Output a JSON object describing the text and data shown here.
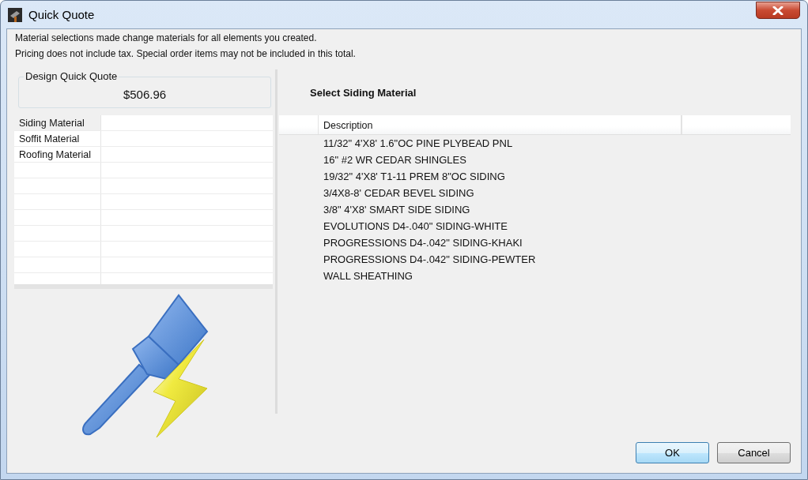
{
  "window": {
    "title": "Quick Quote"
  },
  "notes": [
    "Material selections made change materials for all elements you created.",
    "Pricing does not include tax. Special order items may not be included in this total."
  ],
  "quote": {
    "legend": "Design Quick Quote",
    "total": "$506.96"
  },
  "materials": [
    {
      "name": "Siding Material",
      "selected": true
    },
    {
      "name": "Soffit Material",
      "selected": false
    },
    {
      "name": "Roofing Material",
      "selected": false
    }
  ],
  "picker": {
    "title": "Select Siding Material",
    "columns": [
      "Description"
    ],
    "rows": [
      {
        "description": "11/32\" 4'X8' 1.6\"OC PINE PLYBEAD PNL"
      },
      {
        "description": "16\" #2 WR CEDAR SHINGLES"
      },
      {
        "description": "19/32\" 4'X8' T1-11 PREM 8\"OC SIDING"
      },
      {
        "description": "3/4X8-8' CEDAR BEVEL SIDING"
      },
      {
        "description": "3/8\" 4'X8' SMART SIDE SIDING"
      },
      {
        "description": "EVOLUTIONS D4-.040\" SIDING-WHITE"
      },
      {
        "description": "PROGRESSIONS D4-.042\" SIDING-KHAKI"
      },
      {
        "description": "PROGRESSIONS D4-.042\" SIDING-PEWTER"
      },
      {
        "description": "WALL SHEATHING"
      }
    ]
  },
  "buttons": [
    {
      "label": "OK",
      "default": true
    },
    {
      "label": "Cancel",
      "default": false
    }
  ]
}
